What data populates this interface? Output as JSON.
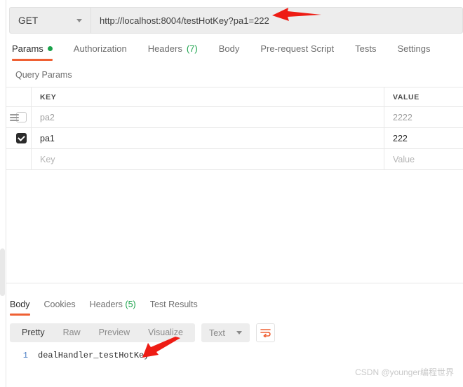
{
  "request": {
    "method": "GET",
    "method_caret_icon": "chevron-down-icon",
    "url": "http://localhost:8004/testHotKey?pa1=222",
    "tabs": [
      {
        "label": "Params",
        "badge": "",
        "dot": true,
        "active": true
      },
      {
        "label": "Authorization",
        "badge": "",
        "dot": false,
        "active": false
      },
      {
        "label": "Headers",
        "badge": "(7)",
        "dot": false,
        "active": false
      },
      {
        "label": "Body",
        "badge": "",
        "dot": false,
        "active": false
      },
      {
        "label": "Pre-request Script",
        "badge": "",
        "dot": false,
        "active": false
      },
      {
        "label": "Tests",
        "badge": "",
        "dot": false,
        "active": false
      },
      {
        "label": "Settings",
        "badge": "",
        "dot": false,
        "active": false
      }
    ]
  },
  "params": {
    "section_title": "Query Params",
    "columns": {
      "key": "KEY",
      "value": "VALUE"
    },
    "rows": [
      {
        "checked": false,
        "drag_handle": true,
        "key": "pa2",
        "value": "2222",
        "muted": true
      },
      {
        "checked": true,
        "drag_handle": false,
        "key": "pa1",
        "value": "222",
        "muted": false
      },
      {
        "checked": false,
        "drag_handle": false,
        "key": "Key",
        "value": "Value",
        "muted": true,
        "placeholder": true
      }
    ]
  },
  "response": {
    "tabs": [
      {
        "label": "Body",
        "badge": "",
        "active": true
      },
      {
        "label": "Cookies",
        "badge": "",
        "active": false
      },
      {
        "label": "Headers",
        "badge": "(5)",
        "active": false
      },
      {
        "label": "Test Results",
        "badge": "",
        "active": false
      }
    ],
    "view_modes": [
      {
        "label": "Pretty",
        "active": true
      },
      {
        "label": "Raw",
        "active": false
      },
      {
        "label": "Preview",
        "active": false
      },
      {
        "label": "Visualize",
        "active": false
      }
    ],
    "format": "Text",
    "format_caret_icon": "chevron-down-icon",
    "wrap_icon": "word-wrap-icon",
    "body": {
      "line_number": "1",
      "text": "dealHandler_testHotKey"
    }
  },
  "watermark": "CSDN @younger编程世界",
  "colors": {
    "accent": "#ef6033",
    "green": "#19a24a",
    "checkbox": "#2b2b2b",
    "arrow": "#ee1c14",
    "toolbar_bg": "#ededed"
  }
}
